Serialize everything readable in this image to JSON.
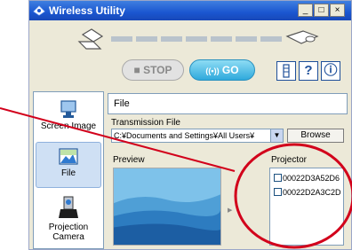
{
  "window": {
    "title": "Wireless Utility",
    "minimize_label": "_",
    "maximize_label": "□",
    "close_label": "×"
  },
  "toolbar": {
    "stop_label": "STOP",
    "go_label": "GO",
    "go_prefix": "((•))",
    "help_label": "?",
    "info_label": "ⓘ",
    "bar_icon": "vertical-bar-icon"
  },
  "sidebar": {
    "items": [
      {
        "label": "Screen Image",
        "icon": "screen-image-icon"
      },
      {
        "label": "File",
        "icon": "file-icon",
        "selected": true
      },
      {
        "label": "Projection Camera",
        "icon": "camera-icon"
      }
    ]
  },
  "main": {
    "header": "File",
    "transmission_label": "Transmission File",
    "file_path": "C:¥Documents and Settings¥All Users¥",
    "browse_label": "Browse",
    "preview_label": "Preview",
    "projector_label": "Projector",
    "projectors": [
      "00022D3A52D6",
      "00022D2A3C2D"
    ]
  },
  "colors": {
    "titlebar": "#1a56d0",
    "go_button": "#2fa9dc",
    "annotation": "#d2001b",
    "window_bg": "#ece9d8"
  }
}
